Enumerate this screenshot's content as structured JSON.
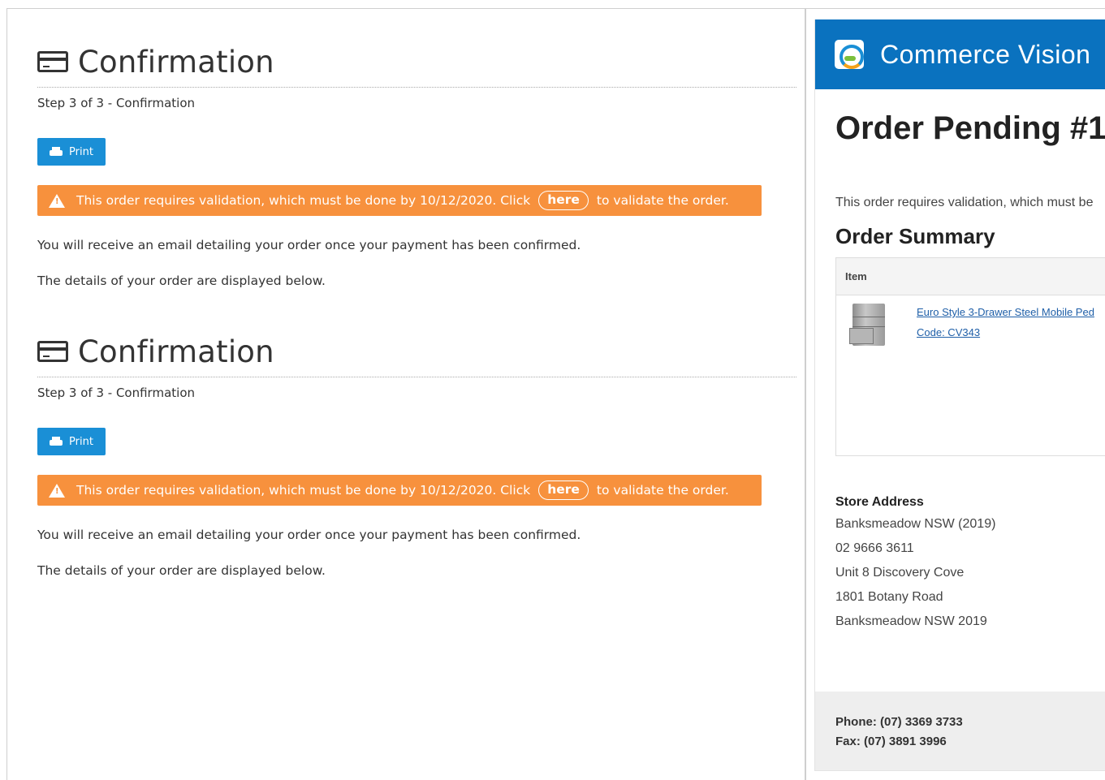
{
  "confirmations": [
    {
      "title": "Confirmation",
      "step": "Step 3 of 3 - Confirmation",
      "print_label": "Print",
      "alert": {
        "before": "This order requires validation, which must be done by 10/12/2020. Click",
        "link": "here",
        "after": "to validate the order."
      },
      "email_note": "You will receive an email detailing your order once your payment has been confirmed.",
      "details_note": "The details of your order are displayed below."
    },
    {
      "title": "Confirmation",
      "step": "Step 3 of 3 - Confirmation",
      "print_label": "Print",
      "alert": {
        "before": "This order requires validation, which must be done by 10/12/2020. Click",
        "link": "here",
        "after": "to validate the order."
      },
      "email_note": "You will receive an email detailing your order once your payment has been confirmed.",
      "details_note": "The details of your order are displayed below."
    }
  ],
  "email_preview": {
    "brand": "Commerce Vision",
    "order_title": "Order Pending #1",
    "validation_text": "This order requires validation, which must be",
    "summary_title": "Order Summary",
    "table_header_item": "Item",
    "item": {
      "name": "Euro Style 3-Drawer Steel Mobile Ped",
      "code": "Code: CV343"
    },
    "store": {
      "title": "Store Address",
      "lines": [
        "Banksmeadow NSW (2019)",
        "02 9666 3611",
        "Unit 8 Discovery Cove",
        "1801 Botany Road",
        "Banksmeadow NSW 2019"
      ]
    },
    "footer": {
      "phone": "Phone: (07) 3369 3733",
      "fax": "Fax: (07) 3891 3996"
    }
  },
  "colors": {
    "accent_blue": "#1a8fd6",
    "header_blue": "#0a72bf",
    "alert_orange": "#f7913d",
    "link_blue": "#1f5fa8"
  },
  "icons": [
    "credit-card-icon",
    "printer-icon",
    "warning-icon",
    "commerce-vision-logo"
  ]
}
